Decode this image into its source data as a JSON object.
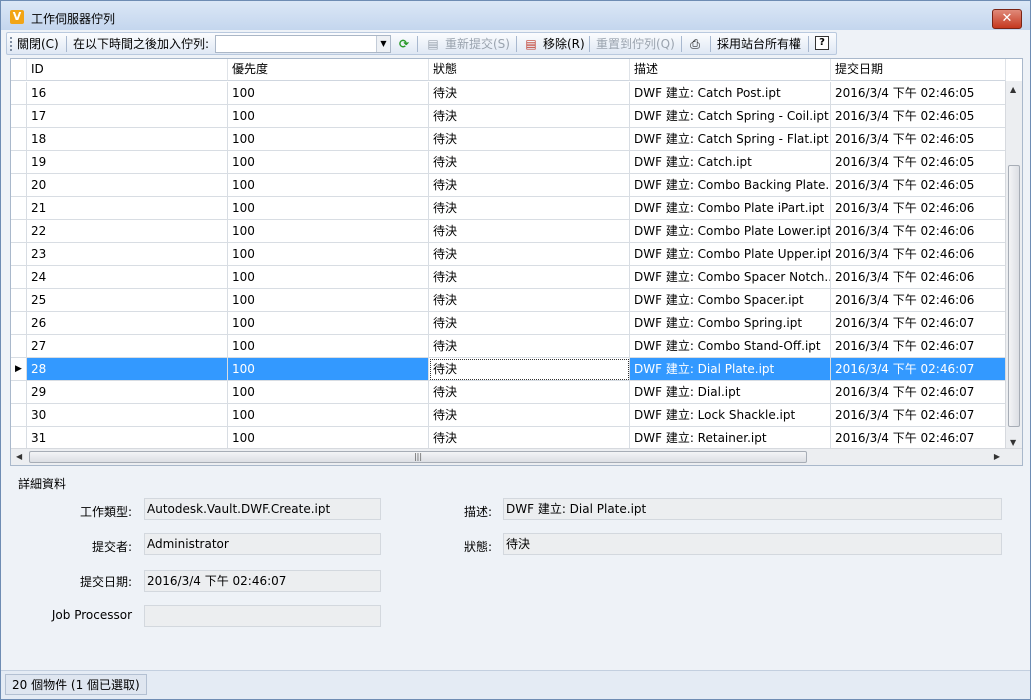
{
  "window": {
    "title": "工作伺服器佇列",
    "close_label": "✕",
    "app_icon": "V"
  },
  "toolbar": {
    "close_label": "關閉(C)",
    "add_after_label": "在以下時間之後加入佇列:",
    "add_after_value": "",
    "resubmit_label": "重新提交(S)",
    "remove_label": "移除(R)",
    "reset_label": "重置到佇列(Q)",
    "take_ownership_label": "採用站台所有權",
    "help_label": "?"
  },
  "grid": {
    "columns": [
      "ID",
      "優先度",
      "狀態",
      "描述",
      "提交日期"
    ],
    "rows": [
      [
        "16",
        "100",
        "待決",
        "DWF 建立: Catch Post.ipt",
        "2016/3/4 下午 02:46:05"
      ],
      [
        "17",
        "100",
        "待決",
        "DWF 建立: Catch Spring - Coil.ipt",
        "2016/3/4 下午 02:46:05"
      ],
      [
        "18",
        "100",
        "待決",
        "DWF 建立: Catch Spring - Flat.ipt",
        "2016/3/4 下午 02:46:05"
      ],
      [
        "19",
        "100",
        "待決",
        "DWF 建立: Catch.ipt",
        "2016/3/4 下午 02:46:05"
      ],
      [
        "20",
        "100",
        "待決",
        "DWF 建立: Combo Backing Plate....",
        "2016/3/4 下午 02:46:05"
      ],
      [
        "21",
        "100",
        "待決",
        "DWF 建立: Combo Plate iPart.ipt",
        "2016/3/4 下午 02:46:06"
      ],
      [
        "22",
        "100",
        "待決",
        "DWF 建立: Combo Plate Lower.ipt",
        "2016/3/4 下午 02:46:06"
      ],
      [
        "23",
        "100",
        "待決",
        "DWF 建立: Combo Plate Upper.ipt",
        "2016/3/4 下午 02:46:06"
      ],
      [
        "24",
        "100",
        "待決",
        "DWF 建立: Combo Spacer Notch....",
        "2016/3/4 下午 02:46:06"
      ],
      [
        "25",
        "100",
        "待決",
        "DWF 建立: Combo Spacer.ipt",
        "2016/3/4 下午 02:46:06"
      ],
      [
        "26",
        "100",
        "待決",
        "DWF 建立: Combo Spring.ipt",
        "2016/3/4 下午 02:46:07"
      ],
      [
        "27",
        "100",
        "待決",
        "DWF 建立: Combo Stand-Off.ipt",
        "2016/3/4 下午 02:46:07"
      ],
      [
        "28",
        "100",
        "待決",
        "DWF 建立: Dial Plate.ipt",
        "2016/3/4 下午 02:46:07"
      ],
      [
        "29",
        "100",
        "待決",
        "DWF 建立: Dial.ipt",
        "2016/3/4 下午 02:46:07"
      ],
      [
        "30",
        "100",
        "待決",
        "DWF 建立: Lock Shackle.ipt",
        "2016/3/4 下午 02:46:07"
      ],
      [
        "31",
        "100",
        "待決",
        "DWF 建立: Retainer.ipt",
        "2016/3/4 下午 02:46:07"
      ]
    ],
    "selected_row_id": "28"
  },
  "details": {
    "title": "詳細資料",
    "job_type_label": "工作類型:",
    "job_type_value": "Autodesk.Vault.DWF.Create.ipt",
    "submitter_label": "提交者:",
    "submitter_value": "Administrator",
    "submit_date_label": "提交日期:",
    "submit_date_value": "2016/3/4 下午 02:46:07",
    "job_processor_label": "Job Processor",
    "job_processor_value": "",
    "description_label": "描述:",
    "description_value": "DWF 建立: Dial Plate.ipt",
    "status_label": "狀態:",
    "status_value": "待決"
  },
  "statusbar": {
    "text": "20 個物件 (1 個已選取)"
  },
  "colors": {
    "selection": "#3399ff",
    "accent": "#f2a516"
  }
}
